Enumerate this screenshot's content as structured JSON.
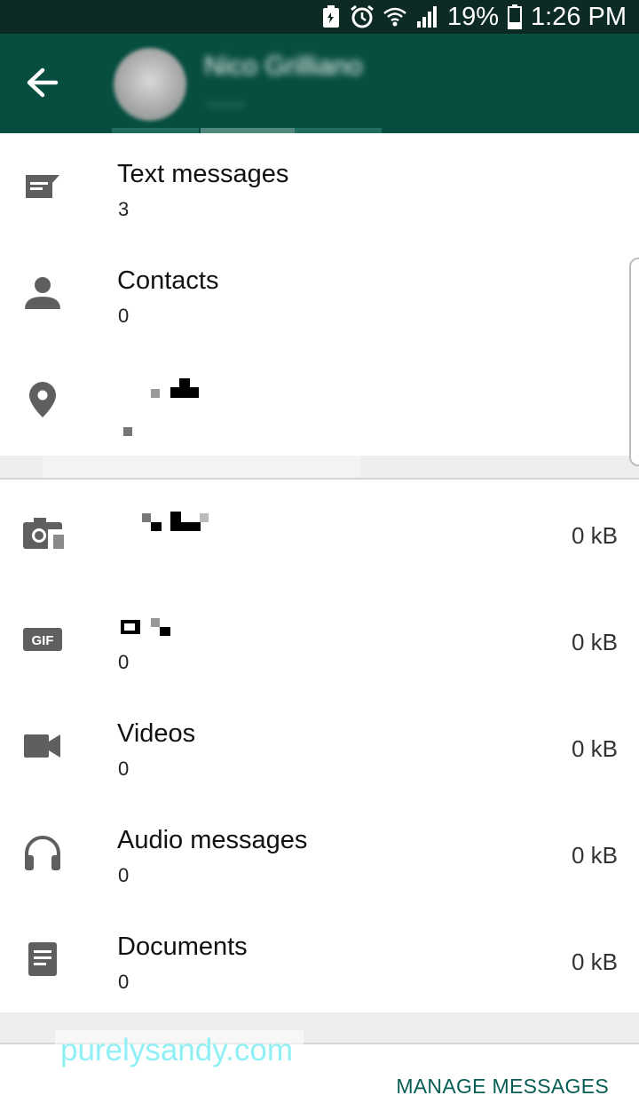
{
  "status_bar": {
    "battery_percent": "19%",
    "time": "1:26 PM",
    "icons": [
      "battery-saver-icon",
      "alarm-icon",
      "wifi-icon",
      "signal-icon",
      "battery-icon"
    ]
  },
  "app_bar": {
    "back_icon": "arrow-back-icon",
    "contact_name": "Nico Grilliano",
    "contact_subtitle": "······"
  },
  "categories_top": [
    {
      "icon": "message-icon",
      "title": "Text messages",
      "count": "3"
    },
    {
      "icon": "person-icon",
      "title": "Contacts",
      "count": "0"
    },
    {
      "icon": "location-pin-icon",
      "title": "",
      "count": ""
    }
  ],
  "categories_media": [
    {
      "icon": "camera-icon",
      "title": "",
      "count": "",
      "size": "0 kB"
    },
    {
      "icon": "gif-icon",
      "title": "",
      "count": "0",
      "size": "0 kB"
    },
    {
      "icon": "videocam-icon",
      "title": "Videos",
      "count": "0",
      "size": "0 kB"
    },
    {
      "icon": "headphones-icon",
      "title": "Audio messages",
      "count": "0",
      "size": "0 kB"
    },
    {
      "icon": "document-icon",
      "title": "Documents",
      "count": "0",
      "size": "0 kB"
    }
  ],
  "footer": {
    "manage_label": "MANAGE MESSAGES",
    "watermark": "purelysandy.com"
  },
  "colors": {
    "app_bar": "#074e40",
    "status_bar": "#0d2b24",
    "accent": "#075e54",
    "icon_gray": "#5f5f5f"
  }
}
